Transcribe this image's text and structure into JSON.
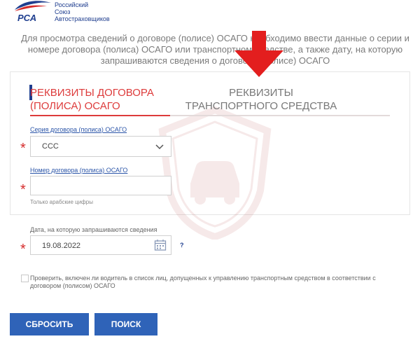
{
  "logo": {
    "abbr": "РСА",
    "line1": "Российский",
    "line2": "Союз",
    "line3": "Автостраховщиков",
    "icon": "rsa-logo-icon"
  },
  "intro": {
    "text": "Для просмотра сведений о договоре (полисе) ОСАГО необходимо ввести данные о серии и номере договора (полиса) ОСАГО или транспортном средстве, а также дату, на которую запрашиваются сведения о договоре (полисе) ОСАГО"
  },
  "tabs": [
    {
      "label": "РЕКВИЗИТЫ ДОГОВОРА (ПОЛИСА) ОСАГО",
      "active": true
    },
    {
      "label": "РЕКВИЗИТЫ ТРАНСПОРТНОГО СРЕДСТВА",
      "active": false
    }
  ],
  "form": {
    "series_label": "Серия договора (полиса) ОСАГО",
    "series_value": "ССС",
    "number_label": "Номер договора (полиса) ОСАГО",
    "number_value": "",
    "number_hint": "Только арабские цифры",
    "date_label": "Дата, на которую запрашиваются сведения",
    "date_value": "19.08.2022",
    "help_mark": "?",
    "required_mark": "*",
    "checkbox_label": "Проверить, включен ли водитель в список лиц, допущенных к управлению транспортным средством в соответствии с договором (полисом) ОСАГО",
    "checkbox_checked": false
  },
  "buttons": {
    "reset": "СБРОСИТЬ",
    "search": "ПОИСК"
  },
  "colors": {
    "brand_blue": "#1f3e8f",
    "accent_red": "#dd3b3b",
    "button_blue": "#2f63b8",
    "arrow_red": "#e31e1e"
  }
}
